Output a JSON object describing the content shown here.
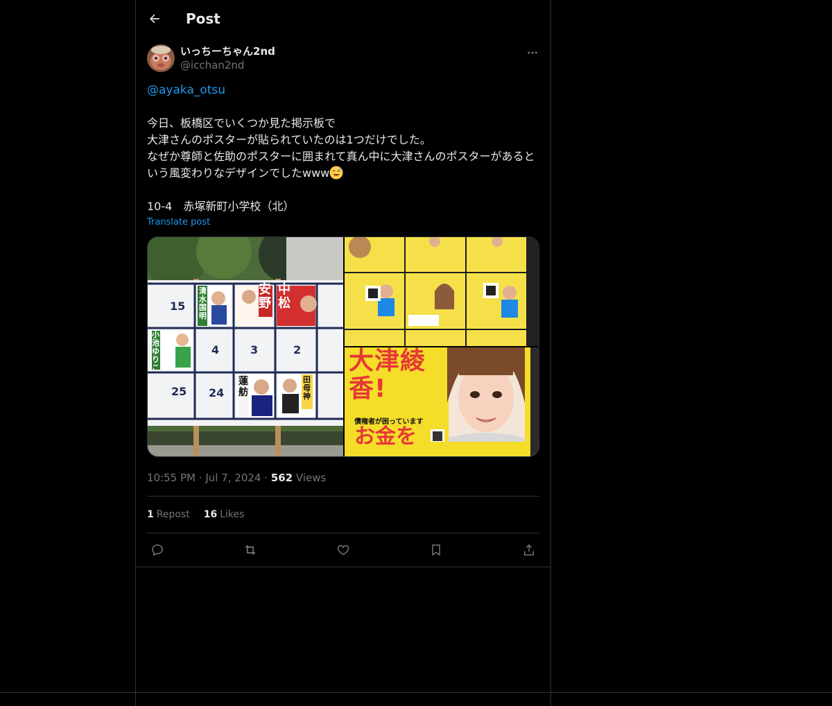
{
  "header": {
    "title": "Post"
  },
  "author": {
    "name": "いっちーちゃん2nd",
    "handle": "@icchan2nd"
  },
  "post": {
    "mention": "@ayaka_otsu",
    "lines": [
      "今日、板橋区でいくつか見た掲示板で",
      "大津さんのポスターが貼られていたのは1つだけでした。",
      "なぜか尊師と佐助のポスターに囲まれて真ん中に大津さんのポスターがあ",
      "るという風変わりなデザインでしたwww"
    ],
    "location": "10-4　赤塚新町小学校（北）",
    "translate": "Translate post"
  },
  "media": {
    "board_numbers": [
      "15",
      "4",
      "3",
      "2",
      "25",
      "24"
    ],
    "poster_names": [
      "清水国明",
      "安野",
      "中松",
      "小池ゆりこ",
      "蓮舫",
      "田母神"
    ],
    "poster_big_title": "大津綾香!",
    "poster_subtitle": "債権者が困っています",
    "poster_slogan": "お金を"
  },
  "meta": {
    "time": "10:55 PM",
    "sep": "·",
    "date": "Jul 7, 2024",
    "views_count": "562",
    "views_label": "Views"
  },
  "stats": {
    "reposts_count": "1",
    "reposts_label": "Repost",
    "likes_count": "16",
    "likes_label": "Likes"
  },
  "icons": {
    "back": "arrow-left-icon",
    "more": "more-icon",
    "reply": "reply-icon",
    "repost": "repost-icon",
    "like": "heart-icon",
    "bookmark": "bookmark-icon",
    "share": "share-icon"
  },
  "colors": {
    "accent": "#1d9bf0",
    "text": "#e7e9ea",
    "muted": "#71767b",
    "border": "#2f3336",
    "bg": "#000000"
  }
}
